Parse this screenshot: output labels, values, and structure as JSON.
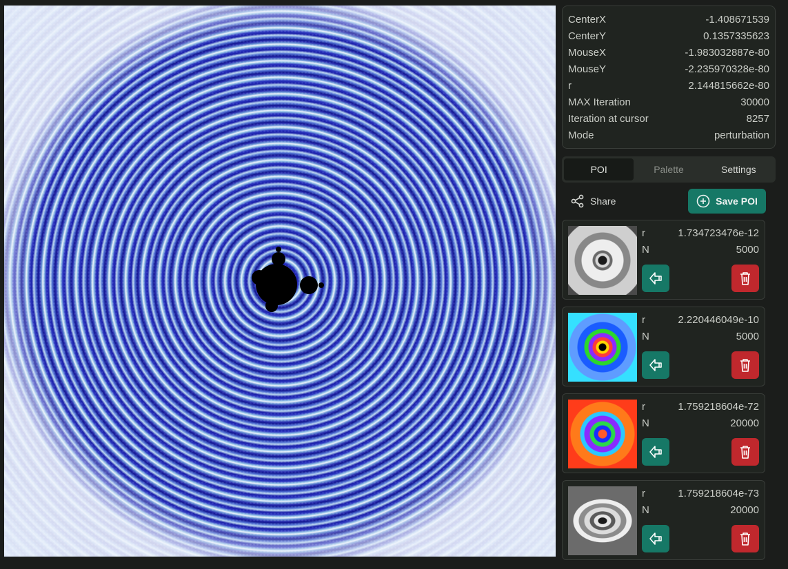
{
  "viewer": {
    "centerx_label": "CenterX",
    "centerx": "-1.408671539",
    "centery_label": "CenterY",
    "centery": "0.1357335623",
    "mousex_label": "MouseX",
    "mousex": "-1.983032887e-80",
    "mousey_label": "MouseY",
    "mousey": "-2.235970328e-80",
    "r_label": "r",
    "r": "2.144815662e-80",
    "maxiter_label": "MAX Iteration",
    "maxiter": "30000",
    "itercursor_label": "Iteration at cursor",
    "itercursor": "8257",
    "mode_label": "Mode",
    "mode": "perturbation"
  },
  "tabs": [
    {
      "label": "POI",
      "active": true
    },
    {
      "label": "Palette",
      "active": false
    },
    {
      "label": "Settings",
      "active": false
    }
  ],
  "actions": {
    "share_label": "Share",
    "save_label": "Save POI"
  },
  "poi": [
    {
      "r_label": "r",
      "r": "1.734723476e-12",
      "n_label": "N",
      "n": "5000",
      "thumb_icon": "grayscale-fractal-thumbnail"
    },
    {
      "r_label": "r",
      "r": "2.220446049e-10",
      "n_label": "N",
      "n": "5000",
      "thumb_icon": "rainbow-fractal-thumbnail"
    },
    {
      "r_label": "r",
      "r": "1.759218604e-72",
      "n_label": "N",
      "n": "20000",
      "thumb_icon": "orange-fractal-thumbnail"
    },
    {
      "r_label": "r",
      "r": "1.759218604e-73",
      "n_label": "N",
      "n": "20000",
      "thumb_icon": "grayscale-fractal-thumbnail"
    }
  ],
  "colors": {
    "accent": "#167866",
    "danger": "#c0282d",
    "panel": "#202420",
    "background": "#1b1d1b"
  }
}
